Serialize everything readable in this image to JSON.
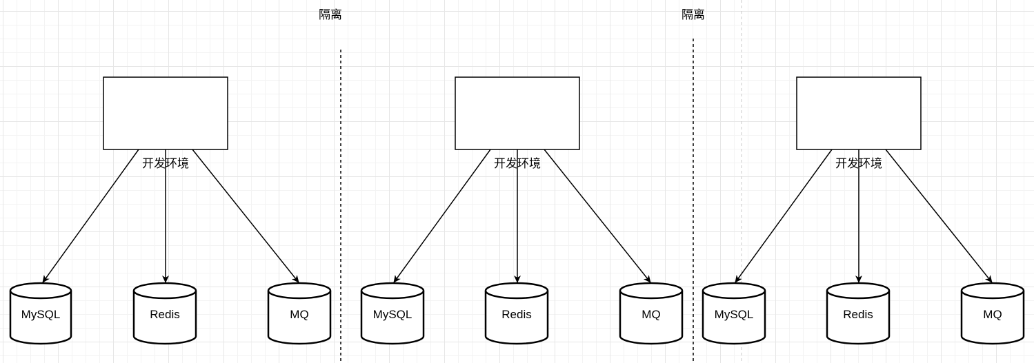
{
  "diagram": {
    "separator_labels": [
      "隔离",
      "隔离"
    ],
    "environments": [
      {
        "label": "开发环境",
        "databases": [
          {
            "name": "MySQL"
          },
          {
            "name": "Redis"
          },
          {
            "name": "MQ"
          }
        ]
      },
      {
        "label": "开发环境",
        "databases": [
          {
            "name": "MySQL"
          },
          {
            "name": "Redis"
          },
          {
            "name": "MQ"
          }
        ]
      },
      {
        "label": "开发环境",
        "databases": [
          {
            "name": "MySQL"
          },
          {
            "name": "Redis"
          },
          {
            "name": "MQ"
          }
        ]
      }
    ]
  },
  "colors": {
    "stroke": "#000000",
    "fill": "#ffffff",
    "grid_major": "#e6e6e6",
    "grid_minor": "#f3f3f3",
    "faint_separator": "#c8c8c8"
  }
}
